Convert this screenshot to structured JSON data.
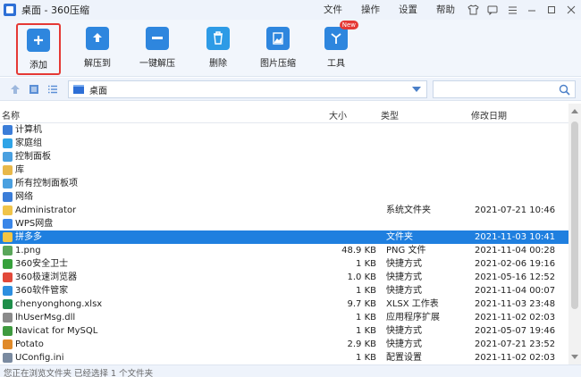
{
  "window": {
    "title": "桌面 - 360压缩"
  },
  "menu": [
    "文件",
    "操作",
    "设置",
    "帮助"
  ],
  "toolbar": {
    "add": "添加",
    "extract_to": "解压到",
    "one_click": "一键解压",
    "delete": "删除",
    "image_compress": "图片压缩",
    "tools": "工具",
    "new_badge": "New"
  },
  "address": {
    "current": "桌面"
  },
  "columns": {
    "name": "名称",
    "size": "大小",
    "type": "类型",
    "modified": "修改日期"
  },
  "rows": [
    {
      "name": "计算机",
      "size": "",
      "type": "",
      "date": "",
      "icon": "computer-icon",
      "color": "#3b7dd8"
    },
    {
      "name": "家庭组",
      "size": "",
      "type": "",
      "date": "",
      "icon": "homegroup-icon",
      "color": "#2fa4e7"
    },
    {
      "name": "控制面板",
      "size": "",
      "type": "",
      "date": "",
      "icon": "control-panel-icon",
      "color": "#4aa0e0"
    },
    {
      "name": "库",
      "size": "",
      "type": "",
      "date": "",
      "icon": "library-icon",
      "color": "#e8b84a"
    },
    {
      "name": "所有控制面板项",
      "size": "",
      "type": "",
      "date": "",
      "icon": "control-panel-icon",
      "color": "#4aa0e0"
    },
    {
      "name": "网络",
      "size": "",
      "type": "",
      "date": "",
      "icon": "network-icon",
      "color": "#3b7dd8"
    },
    {
      "name": "Administrator",
      "size": "",
      "type": "系统文件夹",
      "date": "2021-07-21 10:46",
      "icon": "user-folder-icon",
      "color": "#f0c44a"
    },
    {
      "name": "WPS网盘",
      "size": "",
      "type": "",
      "date": "",
      "icon": "cloud-icon",
      "color": "#3a86e8"
    },
    {
      "name": "拼多多",
      "size": "",
      "type": "文件夹",
      "date": "2021-11-03 10:41",
      "icon": "folder-icon",
      "color": "#f4c542"
    },
    {
      "name": "1.png",
      "size": "48.9 KB",
      "type": "PNG 文件",
      "date": "2021-11-04 00:28",
      "icon": "image-file-icon",
      "color": "#5aa65a"
    },
    {
      "name": "360安全卫士",
      "size": "1 KB",
      "type": "快捷方式",
      "date": "2021-02-06 19:16",
      "icon": "360-safe-icon",
      "color": "#37a13c"
    },
    {
      "name": "360极速浏览器",
      "size": "1.0 KB",
      "type": "快捷方式",
      "date": "2021-05-16 12:52",
      "icon": "360-browser-icon",
      "color": "#e2493a"
    },
    {
      "name": "360软件管家",
      "size": "1 KB",
      "type": "快捷方式",
      "date": "2021-11-04 00:07",
      "icon": "360-software-icon",
      "color": "#2d8fe0"
    },
    {
      "name": "chenyonghong.xlsx",
      "size": "9.7 KB",
      "type": "XLSX 工作表",
      "date": "2021-11-03 23:48",
      "icon": "excel-file-icon",
      "color": "#1e8e4a"
    },
    {
      "name": "lhUserMsg.dll",
      "size": "1 KB",
      "type": "应用程序扩展",
      "date": "2021-11-02 02:03",
      "icon": "dll-file-icon",
      "color": "#8a8a8a"
    },
    {
      "name": "Navicat for MySQL",
      "size": "1 KB",
      "type": "快捷方式",
      "date": "2021-05-07 19:46",
      "icon": "navicat-icon",
      "color": "#3f9a3f"
    },
    {
      "name": "Potato",
      "size": "2.9 KB",
      "type": "快捷方式",
      "date": "2021-07-21 23:52",
      "icon": "potato-icon",
      "color": "#e08a2a"
    },
    {
      "name": "UConfig.ini",
      "size": "1 KB",
      "type": "配置设置",
      "date": "2021-11-02 02:03",
      "icon": "ini-file-icon",
      "color": "#7a8aa0"
    }
  ],
  "selected_row": 8,
  "status": "您正在浏览文件夹 已经选择 1 个文件夹"
}
